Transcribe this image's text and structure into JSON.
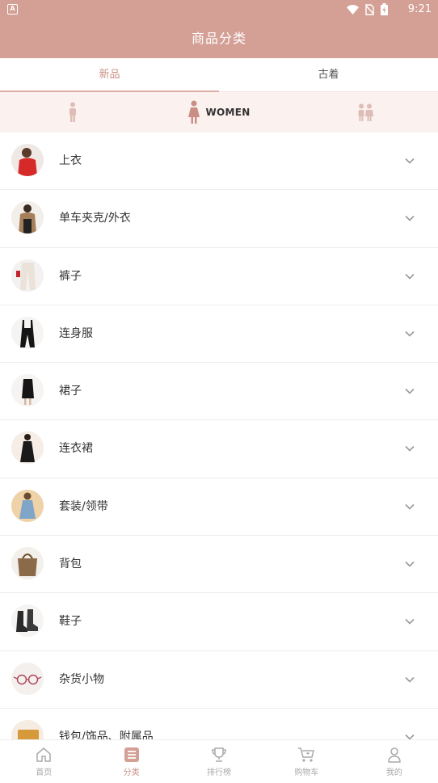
{
  "status": {
    "time": "9:21",
    "notification_glyph": "A"
  },
  "header": {
    "title": "商品分类"
  },
  "tabs": [
    {
      "label": "新品",
      "active": true
    },
    {
      "label": "古着",
      "active": false
    }
  ],
  "gender": {
    "selected_label": "WOMEN",
    "icons": [
      "man-icon",
      "woman-icon",
      "kids-icon"
    ]
  },
  "categories": [
    {
      "label": "上衣",
      "thumb": "red-blouse"
    },
    {
      "label": "单车夹克/外衣",
      "thumb": "tan-jacket"
    },
    {
      "label": "裤子",
      "thumb": "white-pants"
    },
    {
      "label": "连身服",
      "thumb": "black-overalls"
    },
    {
      "label": "裙子",
      "thumb": "black-skirt"
    },
    {
      "label": "连衣裙",
      "thumb": "black-dress"
    },
    {
      "label": "套装/领带",
      "thumb": "blue-dress"
    },
    {
      "label": "背包",
      "thumb": "brown-bag"
    },
    {
      "label": "鞋子",
      "thumb": "black-boots"
    },
    {
      "label": "杂货小物",
      "thumb": "glasses"
    },
    {
      "label": "钱包/饰品、附属品",
      "thumb": "wallet"
    }
  ],
  "bottom_nav": [
    {
      "label": "首页",
      "icon": "home-icon",
      "active": false
    },
    {
      "label": "分类",
      "icon": "category-icon",
      "active": true
    },
    {
      "label": "排行榜",
      "icon": "trophy-icon",
      "active": false
    },
    {
      "label": "购物车",
      "icon": "cart-icon",
      "active": false
    },
    {
      "label": "我的",
      "icon": "user-icon",
      "active": false
    }
  ],
  "colors": {
    "accent": "#d4a096",
    "active_text": "#c98f84",
    "gender_bg": "#fbf1ef"
  }
}
